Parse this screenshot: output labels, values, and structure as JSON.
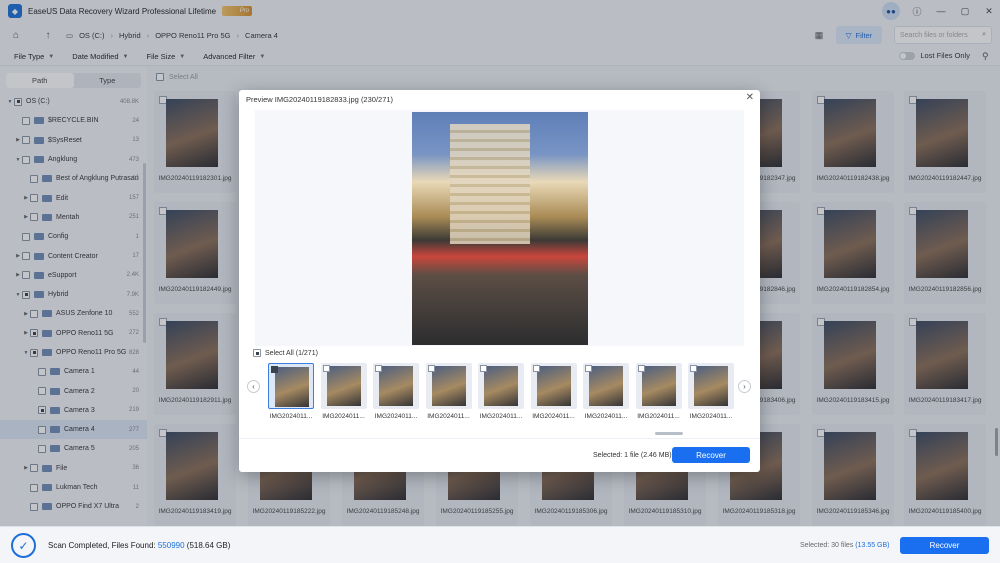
{
  "titlebar": {
    "title": "EaseUS Data Recovery Wizard Professional Lifetime",
    "badge": "Pro",
    "logo_icon": "app-logo-icon"
  },
  "addressbar": {
    "crumbs": [
      "OS (C:)",
      "Hybrid",
      "OPPO Reno11 Pro 5G",
      "Camera 4"
    ],
    "filter_label": "Filter",
    "search_placeholder": "Search files or folders"
  },
  "filterbar": {
    "items": [
      "File Type",
      "Date Modified",
      "File Size",
      "Advanced Filter"
    ],
    "lost_files_label": "Lost Files Only"
  },
  "sidebar": {
    "tabs": [
      "Path",
      "Type"
    ],
    "tree": [
      {
        "label": "OS (C:)",
        "count": "408.8K",
        "level": 0,
        "expand": "▼",
        "check": "partial",
        "folder": false
      },
      {
        "label": "$RECYCLE.BIN",
        "count": "24",
        "level": 1,
        "expand": "",
        "check": "empty",
        "folder": true
      },
      {
        "label": "$SysReset",
        "count": "13",
        "level": 1,
        "expand": "▶",
        "check": "empty",
        "folder": true
      },
      {
        "label": "Angklung",
        "count": "473",
        "level": 1,
        "expand": "▼",
        "check": "empty",
        "folder": true
      },
      {
        "label": "Best of Angklung Putrasari",
        "count": "93",
        "level": 2,
        "expand": "",
        "check": "empty",
        "folder": true
      },
      {
        "label": "Edit",
        "count": "157",
        "level": 2,
        "expand": "▶",
        "check": "empty",
        "folder": true
      },
      {
        "label": "Mentah",
        "count": "251",
        "level": 2,
        "expand": "▶",
        "check": "empty",
        "folder": true
      },
      {
        "label": "Config",
        "count": "1",
        "level": 1,
        "expand": "",
        "check": "empty",
        "folder": true
      },
      {
        "label": "Content Creator",
        "count": "17",
        "level": 1,
        "expand": "▶",
        "check": "empty",
        "folder": true
      },
      {
        "label": "eSupport",
        "count": "2.4K",
        "level": 1,
        "expand": "▶",
        "check": "empty",
        "folder": true
      },
      {
        "label": "Hybrid",
        "count": "7.9K",
        "level": 1,
        "expand": "▼",
        "check": "partial",
        "folder": true
      },
      {
        "label": "ASUS Zenfone 10",
        "count": "552",
        "level": 2,
        "expand": "▶",
        "check": "empty",
        "folder": true
      },
      {
        "label": "OPPO Reno11 5G",
        "count": "272",
        "level": 2,
        "expand": "▶",
        "check": "partial",
        "folder": true
      },
      {
        "label": "OPPO Reno11 Pro 5G",
        "count": "828",
        "level": 2,
        "expand": "▼",
        "check": "partial",
        "folder": true
      },
      {
        "label": "Camera 1",
        "count": "44",
        "level": 3,
        "expand": "",
        "check": "empty",
        "folder": true
      },
      {
        "label": "Camera 2",
        "count": "20",
        "level": 3,
        "expand": "",
        "check": "empty",
        "folder": true
      },
      {
        "label": "Camera 3",
        "count": "219",
        "level": 3,
        "expand": "",
        "check": "partial",
        "folder": true
      },
      {
        "label": "Camera 4",
        "count": "277",
        "level": 3,
        "expand": "",
        "check": "empty",
        "folder": true,
        "selected": true
      },
      {
        "label": "Camera 5",
        "count": "205",
        "level": 3,
        "expand": "",
        "check": "empty",
        "folder": true
      },
      {
        "label": "File",
        "count": "36",
        "level": 2,
        "expand": "▶",
        "check": "empty",
        "folder": true
      },
      {
        "label": "Lukman Tech",
        "count": "11",
        "level": 2,
        "expand": "",
        "check": "empty",
        "folder": true
      },
      {
        "label": "OPPO Find X7 Ultra",
        "count": "2",
        "level": 2,
        "expand": "",
        "check": "empty",
        "folder": true
      }
    ]
  },
  "grid": {
    "select_all_label": "Select All",
    "files": [
      "IMG20240119182301.jpg",
      "IMG20240119182347.jpg",
      "IMG20240119182438.jpg",
      "IMG20240119182447.jpg",
      "IMG20240119182449.jpg",
      "IMG20240119182846.jpg",
      "IMG20240119182854.jpg",
      "IMG20240119182856.jpg",
      "IMG20240119182911.jpg",
      "IMG20240119183406.jpg",
      "IMG20240119183415.jpg",
      "IMG20240119183417.jpg",
      "IMG20240119183419.jpg",
      "IMG20240119185222.jpg",
      "IMG20240119185248.jpg",
      "IMG20240119185255.jpg",
      "IMG20240119185306.jpg",
      "IMG20240119185310.jpg",
      "IMG20240119185318.jpg",
      "IMG20240119185346.jpg",
      "IMG20240119185400.jpg"
    ]
  },
  "modal": {
    "title": "Preview IMG20240119182833.jpg (230/271)",
    "select_all_label": "Select All (1/271)",
    "strip_names": [
      "IMG2024011...",
      "IMG2024011...",
      "IMG2024011...",
      "IMG2024011...",
      "IMG2024011...",
      "IMG2024011...",
      "IMG2024011...",
      "IMG2024011...",
      "IMG2024011..."
    ],
    "selected_info": "Selected: 1 file (2.46 MB)",
    "recover_label": "Recover"
  },
  "bottombar": {
    "scan_prefix": "Scan Completed, Files Found:",
    "files_found": "550990",
    "total_size": "(518.64 GB)",
    "selected_prefix": "Selected: 30 files",
    "selected_size": "(13.55 GB)",
    "recover_label": "Recover"
  },
  "colors": {
    "accent": "#1a6ff0",
    "background": "#eef1f6"
  }
}
